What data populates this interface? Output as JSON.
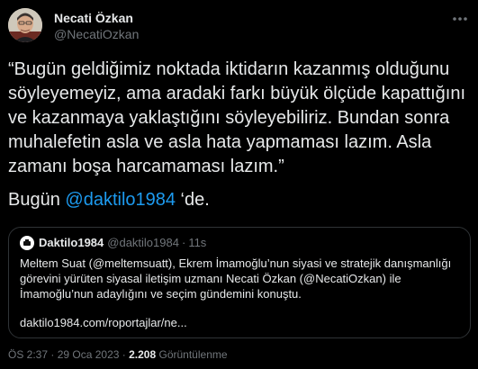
{
  "author": {
    "name": "Necati Özkan",
    "handle": "@NecatiOzkan"
  },
  "tweet": {
    "text": "“Bugün geldiğimiz noktada iktidarın kazanmış olduğunu söyleyemeyiz, ama aradaki farkı büyük ölçüde kapattığını ve kazanmaya yaklaştığını söyleyebiliriz. Bundan sonra muhalefetin asla ve asla hata yapmaması lazım. Asla zamanı boşa harcamaması lazım.”",
    "mention_prefix": "Bugün ",
    "mention": "@daktilo1984",
    "mention_suffix": " ‘de."
  },
  "quote": {
    "name": "Daktilo1984",
    "handle": "@daktilo1984",
    "separator": "·",
    "time": "11s",
    "text": "Meltem Suat (@meltemsuatt), Ekrem İmamoğlu’nun siyasi ve stratejik danışmanlığı görevini yürüten siyasal iletişim uzmanı Necati Özkan (@NecatiOzkan) ile İmamoğlu’nun adaylığını ve seçim gündemini konuştu.",
    "link": "daktilo1984.com/roportajlar/ne..."
  },
  "meta": {
    "time": "ÖS 2:37",
    "separator": "·",
    "date": "29 Oca 2023",
    "views_count": "2.208",
    "views_label": "Görüntülenme"
  },
  "colors": {
    "background": "#000000",
    "text": "#e7e9ea",
    "secondary": "#71767b",
    "link": "#1d9bf0",
    "border": "#2f3336"
  },
  "icons": {
    "avatar": "profile-photo",
    "more": "more-icon",
    "quote_avatar": "daktilo-logo-icon"
  }
}
